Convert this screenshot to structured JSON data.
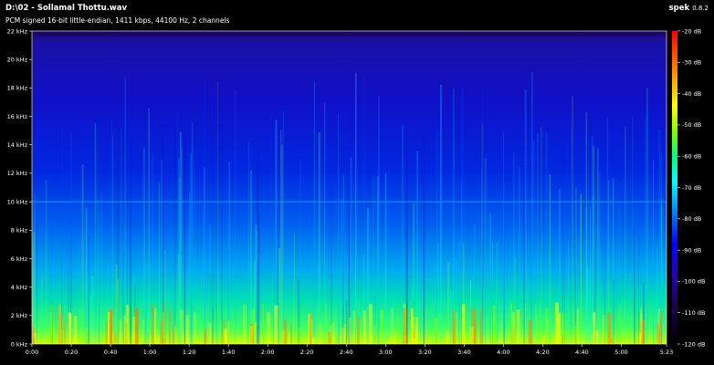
{
  "window": {
    "file_title": "D:\\02 - Sollamal Thottu.wav",
    "info_line": "PCM signed 16-bit little-endian, 1411 kbps, 44100 Hz, 2 channels",
    "app_name": "spek",
    "app_version": "0.8.2"
  },
  "spectrogram": {
    "duration_label": "5:23",
    "freq_axis": {
      "unit": "kHz",
      "min": 0,
      "max": 22,
      "ticks": [
        {
          "value": 0,
          "label": "0 kHz"
        },
        {
          "value": 2,
          "label": "2 kHz"
        },
        {
          "value": 4,
          "label": "4 kHz"
        },
        {
          "value": 6,
          "label": "6 kHz"
        },
        {
          "value": 8,
          "label": "8 kHz"
        },
        {
          "value": 10,
          "label": "10 kHz"
        },
        {
          "value": 12,
          "label": "12 kHz"
        },
        {
          "value": 14,
          "label": "14 kHz"
        },
        {
          "value": 16,
          "label": "16 kHz"
        },
        {
          "value": 18,
          "label": "18 kHz"
        },
        {
          "value": 20,
          "label": "20 kHz"
        },
        {
          "value": 22,
          "label": "22 kHz"
        }
      ]
    },
    "time_axis": {
      "min_seconds": 0,
      "max_seconds": 323,
      "ticks": [
        {
          "value": 0,
          "label": "0:00"
        },
        {
          "value": 20,
          "label": "0:20"
        },
        {
          "value": 40,
          "label": "0:40"
        },
        {
          "value": 60,
          "label": "1:00"
        },
        {
          "value": 80,
          "label": "1:20"
        },
        {
          "value": 100,
          "label": "1:40"
        },
        {
          "value": 120,
          "label": "2:00"
        },
        {
          "value": 140,
          "label": "2:20"
        },
        {
          "value": 160,
          "label": "2:40"
        },
        {
          "value": 180,
          "label": "3:00"
        },
        {
          "value": 200,
          "label": "3:20"
        },
        {
          "value": 220,
          "label": "3:40"
        },
        {
          "value": 240,
          "label": "4:00"
        },
        {
          "value": 260,
          "label": "4:20"
        },
        {
          "value": 280,
          "label": "4:40"
        },
        {
          "value": 300,
          "label": "5:00"
        },
        {
          "value": 323,
          "label": "5:23"
        }
      ]
    },
    "db_scale": {
      "min": -120,
      "max": -20,
      "ticks": [
        {
          "value": -20,
          "label": "-20 dB"
        },
        {
          "value": -30,
          "label": "-30 dB"
        },
        {
          "value": -40,
          "label": "-40 dB"
        },
        {
          "value": -50,
          "label": "-50 dB"
        },
        {
          "value": -60,
          "label": "-60 dB"
        },
        {
          "value": -70,
          "label": "-70 dB"
        },
        {
          "value": -80,
          "label": "-80 dB"
        },
        {
          "value": -90,
          "label": "-90 dB"
        },
        {
          "value": -100,
          "label": "-100 dB"
        },
        {
          "value": -110,
          "label": "-110 dB"
        },
        {
          "value": -120,
          "label": "-120 dB"
        }
      ],
      "palette": [
        "#000000",
        "#1a0050",
        "#2a00b0",
        "#0000ff",
        "#0080ff",
        "#00ffff",
        "#00ff80",
        "#80ff00",
        "#ffff00",
        "#ff8000",
        "#ff0000"
      ]
    }
  }
}
